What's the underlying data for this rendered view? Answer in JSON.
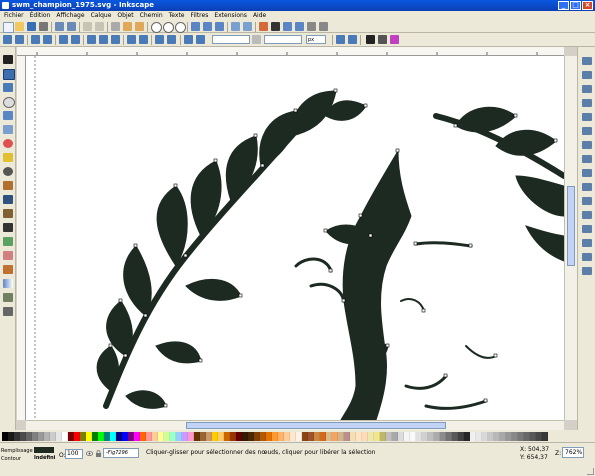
{
  "window": {
    "title": "swm_champion_1975.svg - Inkscape",
    "min": "_",
    "max": "□",
    "close": "×"
  },
  "menubar": [
    "Fichier",
    "Édition",
    "Affichage",
    "Calque",
    "Objet",
    "Chemin",
    "Texte",
    "Filtres",
    "Extensions",
    "Aide"
  ],
  "toolbar2": {
    "x_placeholder": "",
    "unit": "px"
  },
  "status": {
    "fill_label": "Remplissage",
    "stroke_label": "Contour",
    "stroke_value": "Indéfini",
    "opacity_label": "O:",
    "opacity_value": "100",
    "layer": "-Fig7296",
    "message": "Cliquer-glisser pour sélectionner des nœuds, cliquer pour libérer la sélection",
    "coord_x": "X: 504,37",
    "coord_y": "Y: 654,37",
    "zoom_label": "Z:",
    "zoom_value": "762%"
  },
  "palette": [
    "#000000",
    "#1a1a1a",
    "#333333",
    "#4d4d4d",
    "#666666",
    "#808080",
    "#999999",
    "#b3b3b3",
    "#cccccc",
    "#e6e6e6",
    "#ffffff",
    "#800000",
    "#ff0000",
    "#808000",
    "#ffff00",
    "#008000",
    "#00ff00",
    "#008080",
    "#00ffff",
    "#000080",
    "#0000ff",
    "#800080",
    "#ff00ff",
    "#ff6600",
    "#ff9999",
    "#ffcc99",
    "#ffff99",
    "#ccff99",
    "#99ffcc",
    "#99ccff",
    "#cc99ff",
    "#ff99cc",
    "#663300",
    "#996633",
    "#cc9966",
    "#ffcc00",
    "#ffcc66",
    "#cc6600",
    "#993300",
    "#660000",
    "#331a00",
    "#4d2600",
    "#804000",
    "#b35900",
    "#e67300",
    "#ff9933",
    "#ffb366",
    "#ffcc99",
    "#ffe6cc",
    "#fff2e6",
    "#8b4513",
    "#a0522d",
    "#cd853f",
    "#d2691e",
    "#deb887",
    "#f4a460",
    "#d2b48c",
    "#bc8f8f",
    "#f5deb3",
    "#ffe4c4",
    "#ffdab9",
    "#eee8aa",
    "#f0e68c",
    "#bdb76b",
    "#c0c0c0",
    "#a9a9a9",
    "#dcdcdc",
    "#f5f5f5",
    "#fafafa",
    "#e0e0e0",
    "#d0d0d0",
    "#bfbfbf",
    "#ababab",
    "#8c8c8c",
    "#737373",
    "#595959",
    "#404040",
    "#262626",
    "#f0f0f0",
    "#e8e8e8",
    "#d8d8d8",
    "#c8c8c8",
    "#b8b8b8",
    "#a8a8a8",
    "#989898",
    "#888888",
    "#787878",
    "#686868",
    "#585858",
    "#484848",
    "#383838"
  ],
  "icons": {
    "tools": [
      "selector-icon",
      "node-editor-icon",
      "tweak-icon",
      "zoom-icon",
      "rectangle-icon",
      "3dbox-icon",
      "ellipse-icon",
      "star-icon",
      "spiral-icon",
      "pencil-icon",
      "pen-icon",
      "calligraphy-icon",
      "text-icon",
      "spray-icon",
      "eraser-icon",
      "paint-bucket-icon",
      "gradient-icon",
      "dropper-icon",
      "connector-icon"
    ]
  },
  "colors": {
    "artwork": "#1c2a22",
    "title_blue": "#0a58e0"
  }
}
